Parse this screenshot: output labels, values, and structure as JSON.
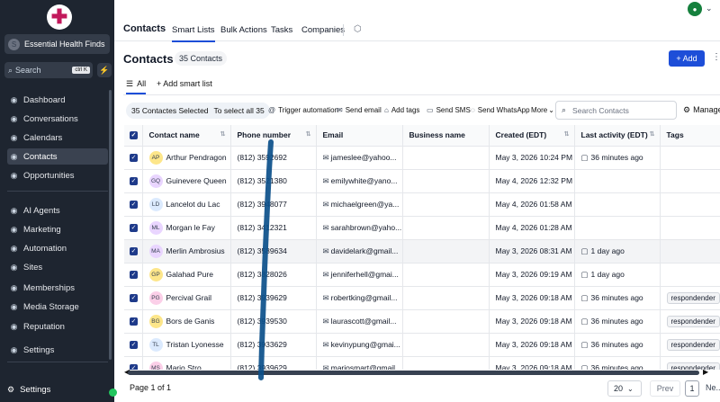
{
  "sidebar": {
    "account_name": "Essential Health Finds",
    "account_initial": "S",
    "search_placeholder": "Search",
    "search_shortcut": "ctrl K",
    "items": [
      {
        "label": "Dashboard",
        "icon": "dashboard-icon"
      },
      {
        "label": "Conversations",
        "icon": "chat-bubble-icon"
      },
      {
        "label": "Calendars",
        "icon": "calendar-icon"
      },
      {
        "label": "Contacts",
        "icon": "contacts-icon"
      },
      {
        "label": "Opportunities",
        "icon": "target-icon"
      },
      {
        "label": "AI Agents",
        "icon": "robot-icon"
      },
      {
        "label": "Marketing",
        "icon": "megaphone-icon"
      },
      {
        "label": "Automation",
        "icon": "automation-icon"
      },
      {
        "label": "Sites",
        "icon": "globe-icon"
      },
      {
        "label": "Memberships",
        "icon": "membership-icon"
      },
      {
        "label": "Media Storage",
        "icon": "folder-icon"
      },
      {
        "label": "Reputation",
        "icon": "star-icon"
      },
      {
        "label": "Settings",
        "icon": "gear-icon"
      }
    ],
    "bottom_settings": "Settings"
  },
  "topbar": {
    "title": "Contacts",
    "tabs": [
      "Smart Lists",
      "Bulk Actions",
      "Tasks",
      "Companies"
    ],
    "active_tab": "Smart Lists"
  },
  "header": {
    "title": "Contacts",
    "count": "35 Contacts",
    "add_label": "+ Add",
    "view_all": "All",
    "add_smart_list": "+ Add smart list"
  },
  "actions": {
    "selected": "35 Contactes Selected",
    "select_all": "To select all 35",
    "items": [
      "Trigger automation",
      "Send email",
      "Add tags",
      "Send SMS",
      "Send WhatsApp",
      "More"
    ],
    "search_placeholder": "Search Contacts",
    "manage": "Manage"
  },
  "table": {
    "columns": [
      "Contact name",
      "Phone number",
      "Email",
      "Business name",
      "Created (EDT)",
      "Last activity (EDT)",
      "Tags"
    ],
    "rows": [
      {
        "initials": "AP",
        "avatar_color": "#fde68a",
        "name": "Arthur Pendragon",
        "phone": "(812) 3592692",
        "email": "jameslee@yahoo...",
        "business": "",
        "created": "May 3, 2026 10:24 PM",
        "activity": "36 minutes ago",
        "tag": ""
      },
      {
        "initials": "GQ",
        "avatar_color": "#e9d5ff",
        "name": "Guinevere Queen",
        "phone": "(812) 3521380",
        "email": "emilywhite@yano...",
        "business": "",
        "created": "May 4, 2026 12:32 PM",
        "activity": "",
        "tag": ""
      },
      {
        "initials": "LD",
        "avatar_color": "#dbeafe",
        "name": "Lancelot du Lac",
        "phone": "(812) 3948077",
        "email": "michaelgreen@ya...",
        "business": "",
        "created": "May 4, 2026 01:58 AM",
        "activity": "",
        "tag": ""
      },
      {
        "initials": "ML",
        "avatar_color": "#e9d5ff",
        "name": "Morgan le Fay",
        "phone": "(812) 3412321",
        "email": "sarahbrown@yaho...",
        "business": "",
        "created": "May 4, 2026 01:28 AM",
        "activity": "",
        "tag": ""
      },
      {
        "initials": "MA",
        "avatar_color": "#e9d5ff",
        "name": "Merlin Ambrosius",
        "phone": "(812) 3589634",
        "email": "davidelark@gmail...",
        "business": "",
        "created": "May 3, 2026 08:31 AM",
        "activity": "1 day ago",
        "tag": ""
      },
      {
        "initials": "GP",
        "avatar_color": "#fde68a",
        "name": "Galahad Pure",
        "phone": "(812) 3828026",
        "email": "jenniferhell@gmai...",
        "business": "",
        "created": "May 3, 2026 09:19 AM",
        "activity": "1 day ago",
        "tag": ""
      },
      {
        "initials": "PG",
        "avatar_color": "#fbcfe8",
        "name": "Percival Grail",
        "phone": "(812) 3939629",
        "email": "robertking@gmail...",
        "business": "",
        "created": "May 3, 2026 09:18 AM",
        "activity": "36 minutes ago",
        "tag": "respondender"
      },
      {
        "initials": "BG",
        "avatar_color": "#fde68a",
        "name": "Bors de Ganis",
        "phone": "(812) 3939530",
        "email": "laurascott@gmail...",
        "business": "",
        "created": "May 3, 2026 09:18 AM",
        "activity": "36 minutes ago",
        "tag": "respondender"
      },
      {
        "initials": "TL",
        "avatar_color": "#dbeafe",
        "name": "Tristan Lyonesse",
        "phone": "(812) 3933629",
        "email": "kevinypung@gmai...",
        "business": "",
        "created": "May 3, 2026 09:18 AM",
        "activity": "36 minutes ago",
        "tag": "respondender"
      },
      {
        "initials": "MS",
        "avatar_color": "#fbcfe8",
        "name": "Mario Stro...",
        "phone": "(812) 3939629",
        "email": "mariosmart@gmail...",
        "business": "",
        "created": "May 3, 2026 09:18 AM",
        "activity": "36 minutes ago",
        "tag": "respondender"
      }
    ],
    "highlight_row": 4
  },
  "footer": {
    "page_info": "Page 1 of 1",
    "per_page": "20",
    "prev": "Prev",
    "page": "1",
    "next": "Ne..."
  },
  "colors": {
    "sidebar_bg": "#1e2530",
    "accent": "#1d4ed8",
    "pen_stroke": "#0b4f8a"
  }
}
